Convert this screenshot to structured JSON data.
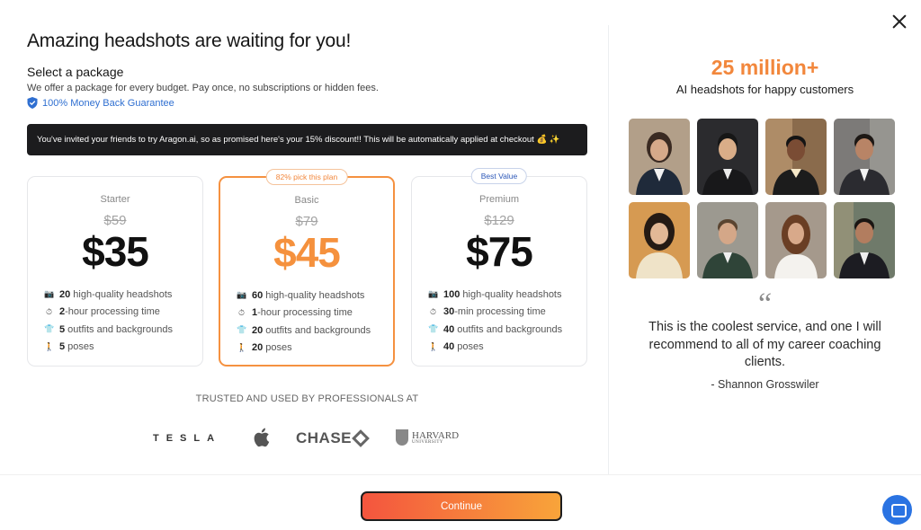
{
  "header": {
    "title": "Amazing headshots are waiting for you!",
    "select_label": "Select a package",
    "description": "We offer a package for every budget. Pay once, no subscriptions or hidden fees.",
    "guarantee": "100% Money Back Guarantee"
  },
  "banner": {
    "text": "You've invited your friends to try Aragon.ai, so as promised here's your 15% discount!! This will be automatically applied at checkout 💰 ✨"
  },
  "plans": [
    {
      "tier": "Starter",
      "old_price": "$59",
      "price": "$35",
      "badge": "",
      "features": [
        {
          "bold": "20",
          "text": " high-quality headshots",
          "icon": "camera-icon"
        },
        {
          "bold": "2",
          "text": "-hour processing time",
          "icon": "timer-icon"
        },
        {
          "bold": "5",
          "text": " outfits and backgrounds",
          "icon": "shirt-icon"
        },
        {
          "bold": "5",
          "text": " poses",
          "icon": "pose-icon"
        }
      ]
    },
    {
      "tier": "Basic",
      "old_price": "$79",
      "price": "$45",
      "badge": "82% pick this plan",
      "features": [
        {
          "bold": "60",
          "text": " high-quality headshots",
          "icon": "camera-icon"
        },
        {
          "bold": "1",
          "text": "-hour processing time",
          "icon": "timer-icon"
        },
        {
          "bold": "20",
          "text": " outfits and backgrounds",
          "icon": "shirt-icon"
        },
        {
          "bold": "20",
          "text": " poses",
          "icon": "pose-icon"
        }
      ]
    },
    {
      "tier": "Premium",
      "old_price": "$129",
      "price": "$75",
      "badge": "Best Value",
      "features": [
        {
          "bold": "100",
          "text": " high-quality headshots",
          "icon": "camera-icon"
        },
        {
          "bold": "30",
          "text": "-min processing time",
          "icon": "timer-icon"
        },
        {
          "bold": "40",
          "text": " outfits and backgrounds",
          "icon": "shirt-icon"
        },
        {
          "bold": "40",
          "text": " poses",
          "icon": "pose-icon"
        }
      ]
    }
  ],
  "trusted": {
    "label": "TRUSTED AND USED BY PROFESSIONALS AT",
    "logos": {
      "tesla": "TESLA",
      "chase": "CHASE",
      "harvard": "HARVARD",
      "harvard_sub": "UNIVERSITY"
    }
  },
  "side": {
    "stat": "25 million+",
    "stat_sub": "AI headshots for happy customers",
    "quote_mark": "“",
    "quote": "This is the coolest service, and one I will recommend to all of my career coaching clients.",
    "author": "- Shannon Grosswiler"
  },
  "footer": {
    "continue_label": "Continue"
  },
  "colors": {
    "accent_orange": "#f5913d",
    "banner_bg": "#1c1c1e",
    "link_blue": "#2f6fd1",
    "chat_blue": "#2a73e2"
  }
}
